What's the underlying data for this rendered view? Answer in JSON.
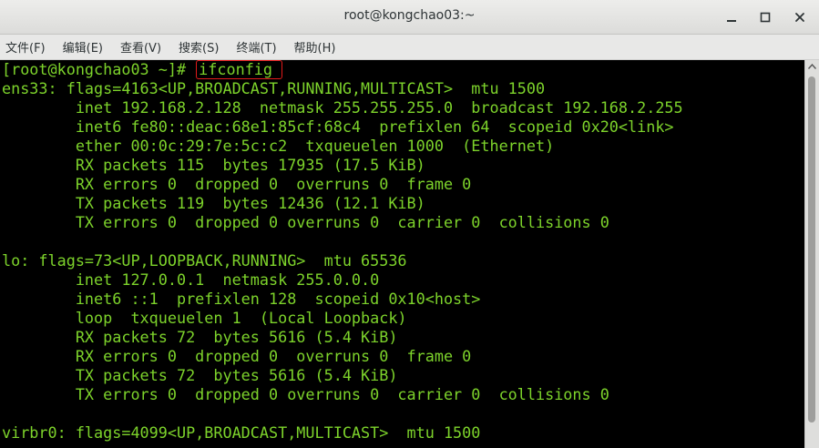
{
  "window": {
    "title": "root@kongchao03:~"
  },
  "menu": [
    {
      "label": "文件(F)"
    },
    {
      "label": "编辑(E)"
    },
    {
      "label": "查看(V)"
    },
    {
      "label": "搜索(S)"
    },
    {
      "label": "终端(T)"
    },
    {
      "label": "帮助(H)"
    }
  ],
  "terminal": {
    "prompt": "[root@kongchao03 ~]# ",
    "command": "ifconfig",
    "lines": [
      "ens33: flags=4163<UP,BROADCAST,RUNNING,MULTICAST>  mtu 1500",
      "        inet 192.168.2.128  netmask 255.255.255.0  broadcast 192.168.2.255",
      "        inet6 fe80::deac:68e1:85cf:68c4  prefixlen 64  scopeid 0x20<link>",
      "        ether 00:0c:29:7e:5c:c2  txqueuelen 1000  (Ethernet)",
      "        RX packets 115  bytes 17935 (17.5 KiB)",
      "        RX errors 0  dropped 0  overruns 0  frame 0",
      "        TX packets 119  bytes 12436 (12.1 KiB)",
      "        TX errors 0  dropped 0 overruns 0  carrier 0  collisions 0",
      "",
      "lo: flags=73<UP,LOOPBACK,RUNNING>  mtu 65536",
      "        inet 127.0.0.1  netmask 255.0.0.0",
      "        inet6 ::1  prefixlen 128  scopeid 0x10<host>",
      "        loop  txqueuelen 1  (Local Loopback)",
      "        RX packets 72  bytes 5616 (5.4 KiB)",
      "        RX errors 0  dropped 0  overruns 0  frame 0",
      "        TX packets 72  bytes 5616 (5.4 KiB)",
      "        TX errors 0  dropped 0 overruns 0  carrier 0  collisions 0",
      "",
      "virbr0: flags=4099<UP,BROADCAST,MULTICAST>  mtu 1500"
    ]
  },
  "colors": {
    "terminal_fg": "#7dd32b",
    "terminal_bg": "#000000",
    "highlight_border": "#e21a1a"
  }
}
